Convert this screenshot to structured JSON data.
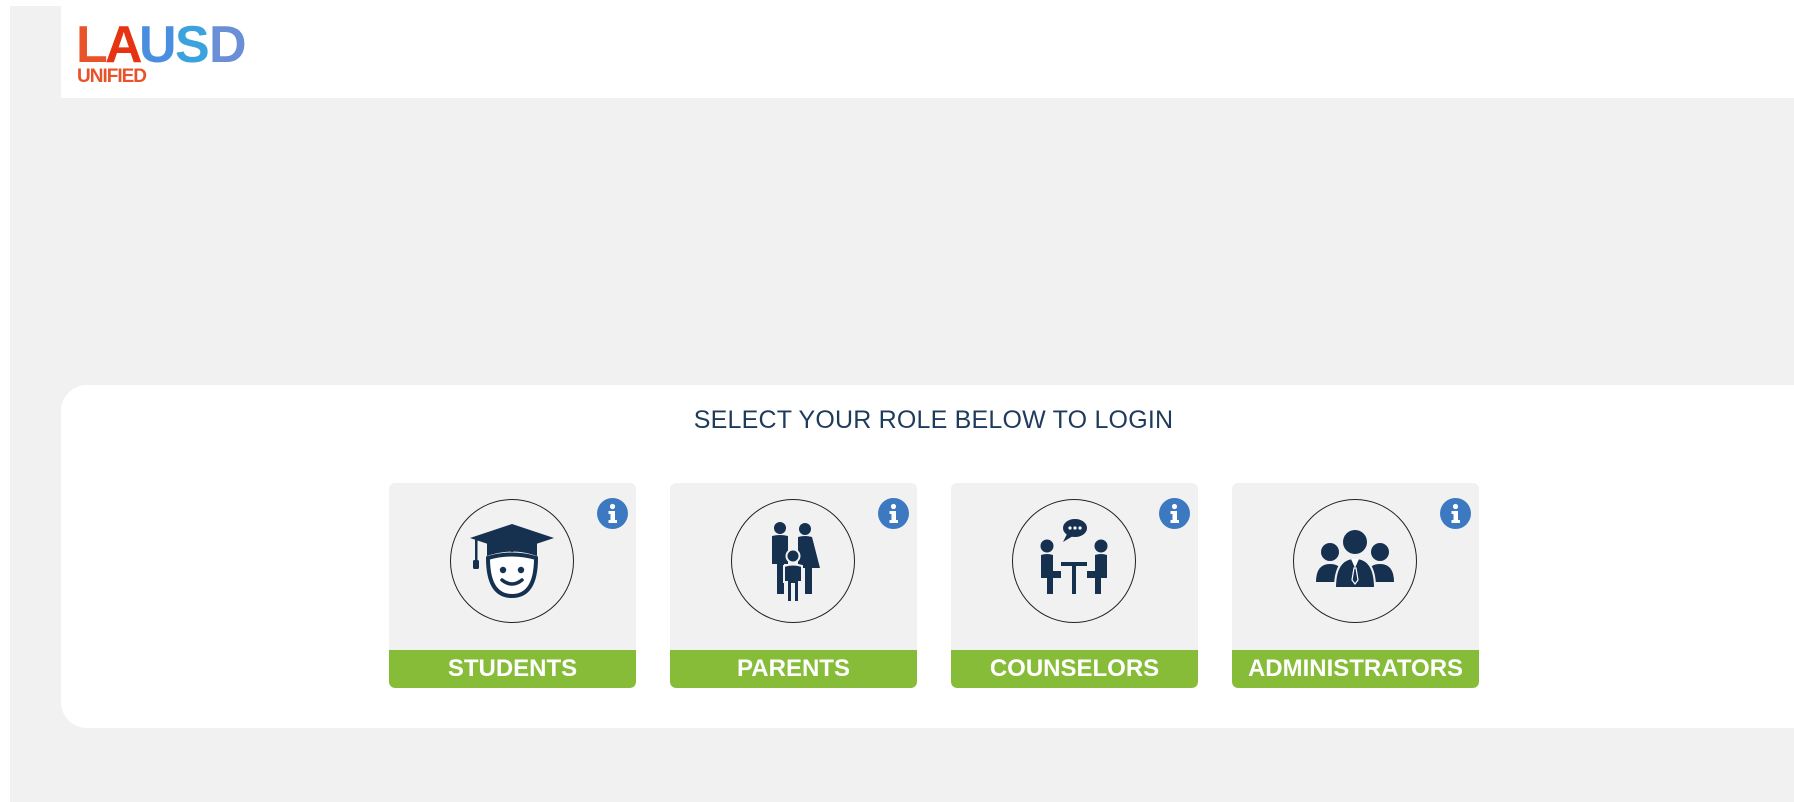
{
  "header": {
    "logo_letters": [
      "L",
      "A",
      "U",
      "S",
      "D"
    ],
    "logo_subtext": "UNIFIED"
  },
  "main": {
    "heading": "SELECT YOUR ROLE BELOW TO LOGIN",
    "roles": [
      {
        "label": "STUDENTS",
        "icon": "student-graduate-icon"
      },
      {
        "label": "PARENTS",
        "icon": "family-icon"
      },
      {
        "label": "COUNSELORS",
        "icon": "counselor-meeting-icon"
      },
      {
        "label": "ADMINISTRATORS",
        "icon": "administrators-group-icon"
      }
    ]
  },
  "colors": {
    "logo_l": "#e8532a",
    "logo_a": "#e63312",
    "logo_u": "#4a8ee0",
    "logo_s": "#3aa3de",
    "logo_d": "#6b8fd6",
    "logo_unified": "#e8532a",
    "heading": "#1f3b5c",
    "label_bg": "#86bc38",
    "info_bg": "#3d79c1",
    "icon": "#16304f"
  }
}
